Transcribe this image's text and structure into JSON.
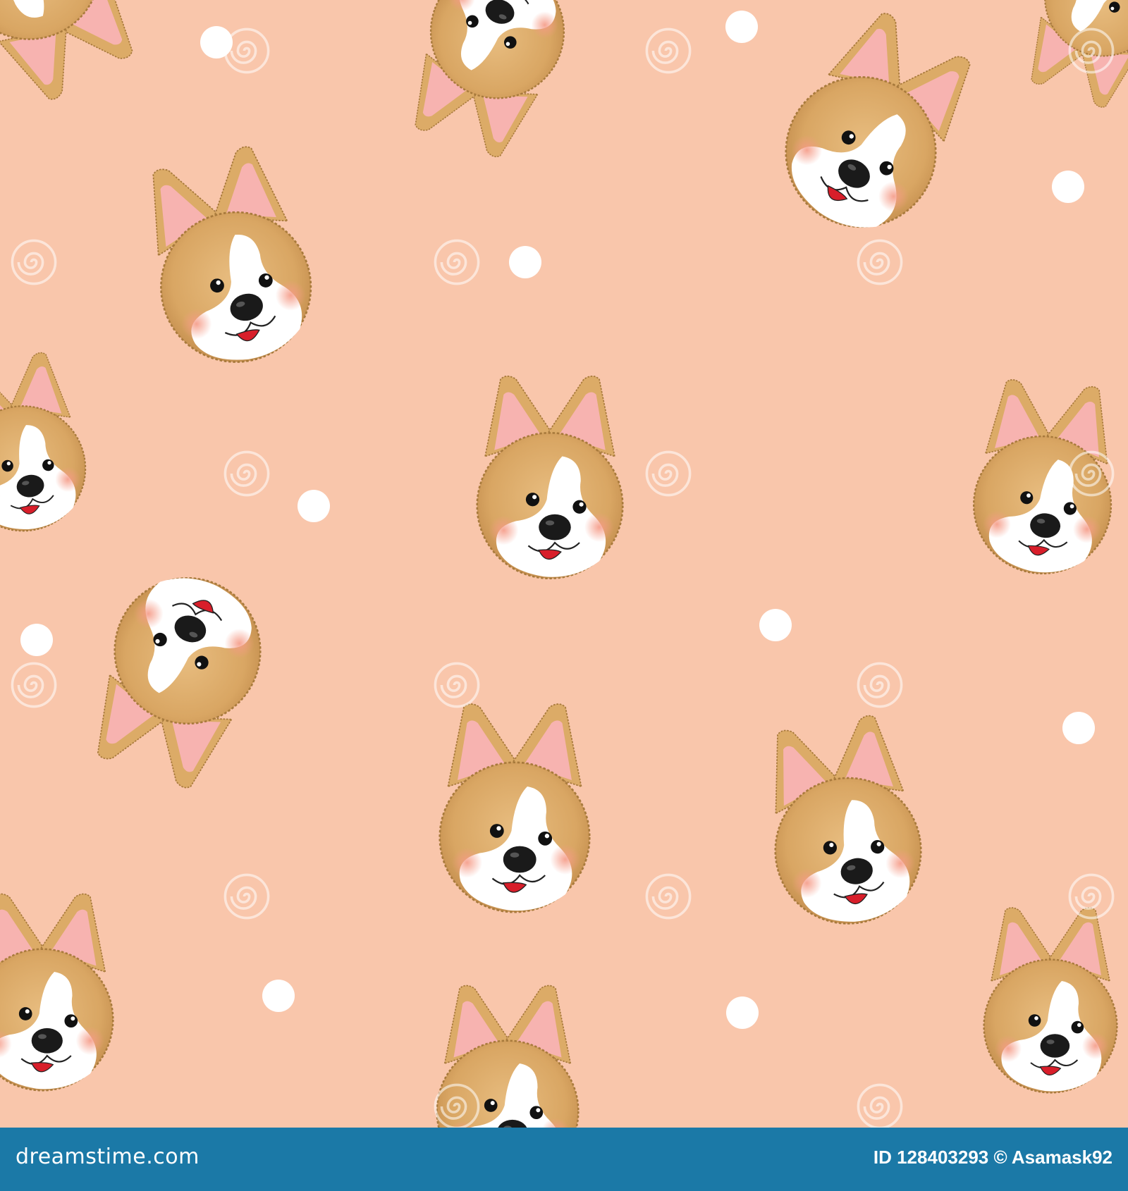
{
  "colors": {
    "background": "#f9c6ab",
    "fur": "#dcab67",
    "fur_edge": "#a87a3c",
    "ear_inner": "#f7b3b0",
    "muzzle": "#ffffff",
    "cheek": "#f6a892",
    "nose": "#1a1a1a",
    "tongue": "#d81e2a",
    "dot": "#ffffff",
    "footer": "#1b79a7"
  },
  "footer": {
    "brand": "dreamstime.com",
    "image_id": "ID 128403293 © Asamask92"
  },
  "watermark": {
    "text": "dreamstime",
    "icon": "spiral-icon"
  }
}
